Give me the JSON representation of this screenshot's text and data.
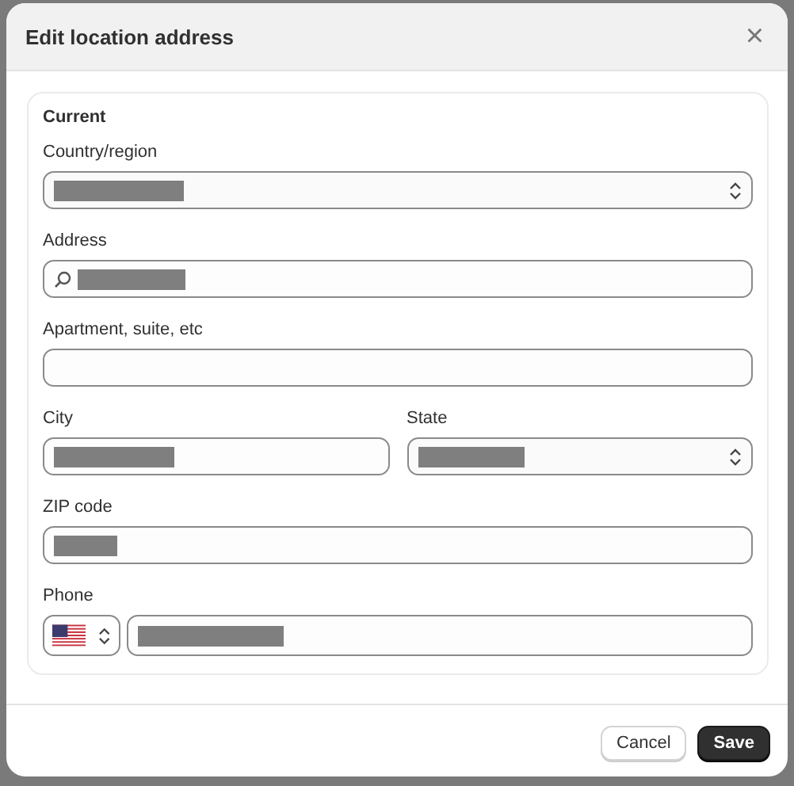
{
  "dialog": {
    "title": "Edit location address",
    "close": "×"
  },
  "section": {
    "heading": "Current"
  },
  "rows": [
    [
      {
        "label": "Country/region",
        "kind": "select",
        "redacted": true
      }
    ],
    [
      {
        "label": "Address",
        "kind": "search",
        "redacted": true
      }
    ],
    [
      {
        "label": "Apartment, suite, etc",
        "kind": "text",
        "redacted": false
      }
    ],
    [
      {
        "label": "City",
        "kind": "text",
        "redacted": true
      },
      {
        "label": "State",
        "kind": "select",
        "redacted": true
      }
    ],
    [
      {
        "label": "ZIP code",
        "kind": "text",
        "redacted": true
      }
    ],
    [
      {
        "label": "Phone",
        "kind": "phone",
        "redacted": true
      }
    ]
  ],
  "buttons": [
    {
      "label": "Cancel",
      "primary": false
    },
    {
      "label": "Save",
      "primary": true
    }
  ]
}
